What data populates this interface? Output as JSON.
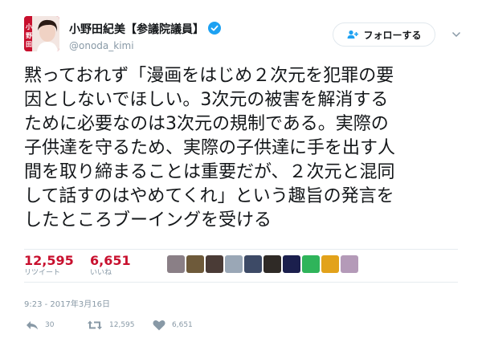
{
  "account": {
    "display_name": "小野田紀美【参議院議員】",
    "screen_name": "@onoda_kimi",
    "avatar_text": "小野田"
  },
  "follow_button": {
    "label": "フォローする"
  },
  "tweet_lines": [
    "黙っておれず「漫画をはじめ２次元を犯罪の要",
    "因としないでほしい。3次元の被害を解消する",
    "ために必要なのは3次元の規制である。実際の",
    "子供達を守るため、実際の子供達に手を出す人",
    "間を取り締まることは重要だが、２次元と混同",
    "して話すのはやめてくれ」という趣旨の発言を",
    "したところブーイングを受ける"
  ],
  "stats": {
    "retweets": {
      "count": "12,595",
      "label": "リツイート"
    },
    "likes": {
      "count": "6,651",
      "label": "いいね"
    }
  },
  "likers": [
    {
      "icon": "liker-avatar",
      "color": "#8a7f86"
    },
    {
      "icon": "liker-avatar",
      "color": "#6e5a3a"
    },
    {
      "icon": "liker-avatar",
      "color": "#4a3b36"
    },
    {
      "icon": "liker-avatar",
      "color": "#9aa7b6"
    },
    {
      "icon": "liker-avatar",
      "color": "#3d4a66"
    },
    {
      "icon": "liker-avatar",
      "color": "#2f2a26"
    },
    {
      "icon": "liker-avatar",
      "color": "#1b1f4d"
    },
    {
      "icon": "liker-avatar",
      "color": "#2fb45a"
    },
    {
      "icon": "liker-avatar",
      "color": "#e2a21b"
    },
    {
      "icon": "liker-avatar",
      "color": "#b49ab8"
    }
  ],
  "timestamp": "9:23 - 2017年3月16日",
  "actions": {
    "reply": {
      "count": "30",
      "icon": "reply-icon"
    },
    "retweet": {
      "count": "12,595",
      "icon": "retweet-icon"
    },
    "like": {
      "count": "6,651",
      "icon": "heart-icon"
    }
  },
  "colors": {
    "accent": "#c8102e",
    "verified": "#1da1f2",
    "muted": "#8899a6",
    "border": "#e6ecf0"
  }
}
